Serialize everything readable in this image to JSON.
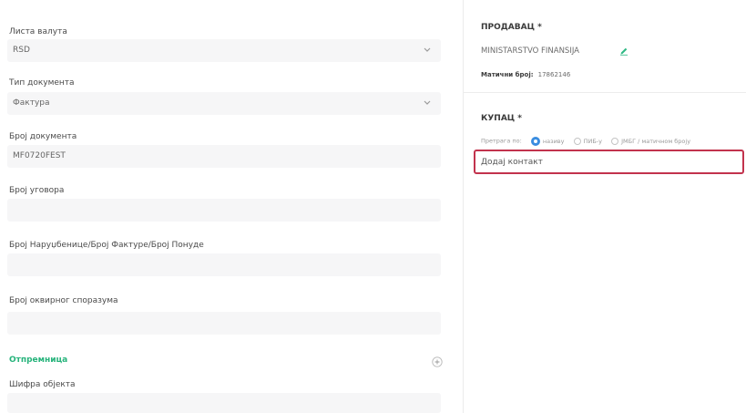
{
  "left": {
    "currency": {
      "label": "Листа валута",
      "value": "RSD"
    },
    "doc_type": {
      "label": "Тип документа",
      "value": "Фактура"
    },
    "doc_number": {
      "label": "Број документа",
      "value": "MF0720FEST"
    },
    "contract_number": {
      "label": "Број уговора",
      "value": ""
    },
    "order_number": {
      "label": "Број Наруџбенице/Број Фактуре/Број Понуде",
      "value": ""
    },
    "framework_number": {
      "label": "Број оквирног споразума",
      "value": ""
    },
    "dispatch": {
      "label": "Отпремница"
    },
    "object_code": {
      "label": "Шифра објекта",
      "value": ""
    }
  },
  "right": {
    "seller": {
      "label": "ПРОДАВАЦ *",
      "name": "MINISTARSTVO FINANSIJA",
      "reg_label": "Матични број:",
      "reg_value": "17862146"
    },
    "buyer": {
      "label": "КУПАЦ *",
      "search_by": "Претрага по:",
      "options": [
        "називу",
        "ПИБ-у",
        "ЈМБГ / матичном броју"
      ],
      "selected_index": 0,
      "contact_placeholder": "Додај контакт"
    }
  },
  "colors": {
    "accent_green": "#26b37b",
    "radio_blue": "#3a8de0",
    "highlight_red": "#c2334d",
    "field_bg": "#f6f6f7"
  }
}
